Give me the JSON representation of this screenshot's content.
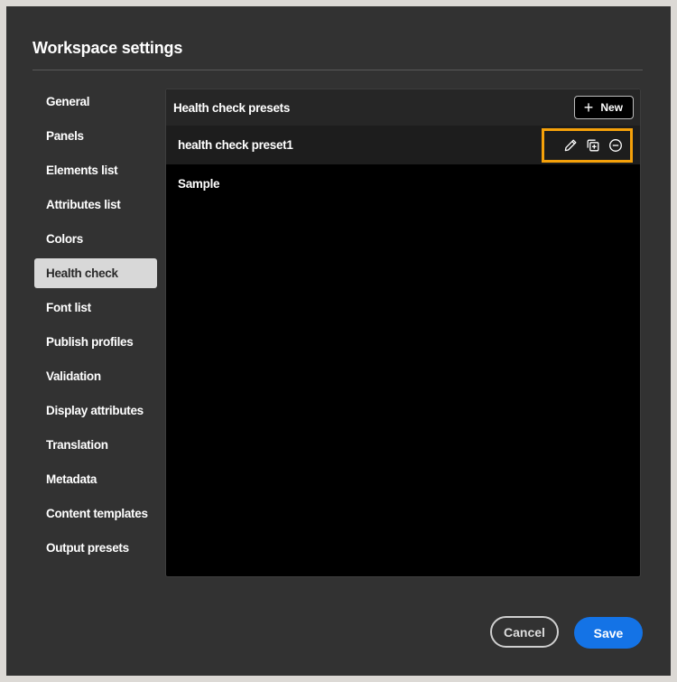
{
  "dialog": {
    "title": "Workspace settings"
  },
  "sidebar": {
    "items": [
      {
        "label": "General",
        "active": false
      },
      {
        "label": "Panels",
        "active": false
      },
      {
        "label": "Elements list",
        "active": false
      },
      {
        "label": "Attributes list",
        "active": false
      },
      {
        "label": "Colors",
        "active": false
      },
      {
        "label": "Health check",
        "active": true
      },
      {
        "label": "Font list",
        "active": false
      },
      {
        "label": "Publish profiles",
        "active": false
      },
      {
        "label": "Validation",
        "active": false
      },
      {
        "label": "Display attributes",
        "active": false
      },
      {
        "label": "Translation",
        "active": false
      },
      {
        "label": "Metadata",
        "active": false
      },
      {
        "label": "Content templates",
        "active": false
      },
      {
        "label": "Output presets",
        "active": false
      }
    ]
  },
  "panel": {
    "title": "Health check presets",
    "new_button_label": "New",
    "presets": [
      {
        "name": "health check preset1",
        "selected": true
      },
      {
        "name": "Sample",
        "selected": false
      }
    ],
    "row_action_icons": [
      "edit-icon",
      "duplicate-icon",
      "remove-icon"
    ]
  },
  "footer": {
    "cancel_label": "Cancel",
    "save_label": "Save"
  },
  "colors": {
    "dialog_bg": "#323232",
    "panel_bg": "#000000",
    "highlight_outline": "#f5a10a",
    "primary_button": "#1473e6",
    "active_sidebar_bg": "#d8d8d8"
  }
}
